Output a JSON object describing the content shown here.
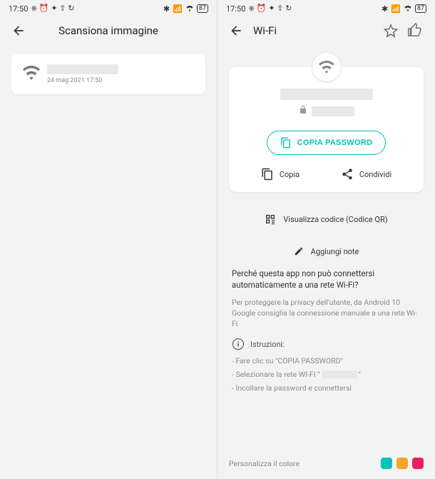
{
  "status": {
    "time": "17:50",
    "battery": "87"
  },
  "left": {
    "title": "Scansiona immagine",
    "item_ts": "24 mag 2021 17:50"
  },
  "right": {
    "title": "Wi-Fi",
    "copy_password": "COPIA PASSWORD",
    "copy": "Copia",
    "share": "Condividi",
    "view_qr": "Visualizza codice (Codice QR)",
    "add_notes": "Aggiungi note",
    "question": "Perché questa app non può connettersi automaticamente a una rete Wi-Fi?",
    "answer": "Per proteggere la privacy dell'utente, da Android 10 Google consiglia la connessione manuale a una rete Wi-Fi",
    "instructions_label": "Istruzioni:",
    "step1": "- Fare clic su \"COPIA PASSWORD\"",
    "step2_pre": "- Selezionare la rete WI-FI \"",
    "step2_post": "\"",
    "step3": "- Incollare la password e connettersi",
    "footer_label": "Personalizza il colore",
    "colors": {
      "c1": "#00c4b4",
      "c2": "#f5a623",
      "c3": "#e91e63"
    }
  }
}
